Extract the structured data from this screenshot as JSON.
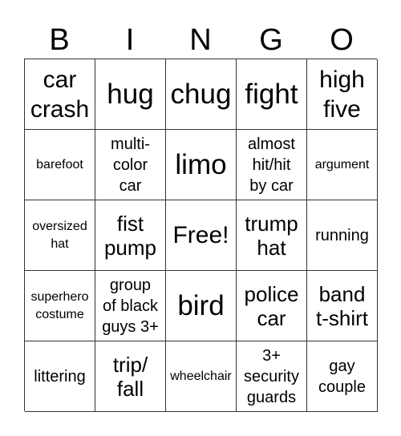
{
  "header": [
    "B",
    "I",
    "N",
    "G",
    "O"
  ],
  "cells": [
    [
      "car\ncrash",
      "hug",
      "chug",
      "fight",
      "high\nfive"
    ],
    [
      "barefoot",
      "multi-\ncolor\ncar",
      "limo",
      "almost\nhit/hit\nby car",
      "argument"
    ],
    [
      "oversized\nhat",
      "fist\npump",
      "Free!",
      "trump\nhat",
      "running"
    ],
    [
      "superhero\ncostume",
      "group\nof black\nguys 3+",
      "bird",
      "police\ncar",
      "band\nt-shirt"
    ],
    [
      "littering",
      "trip/\nfall",
      "wheelchair",
      "3+\nsecurity\nguards",
      "gay\ncouple"
    ]
  ]
}
